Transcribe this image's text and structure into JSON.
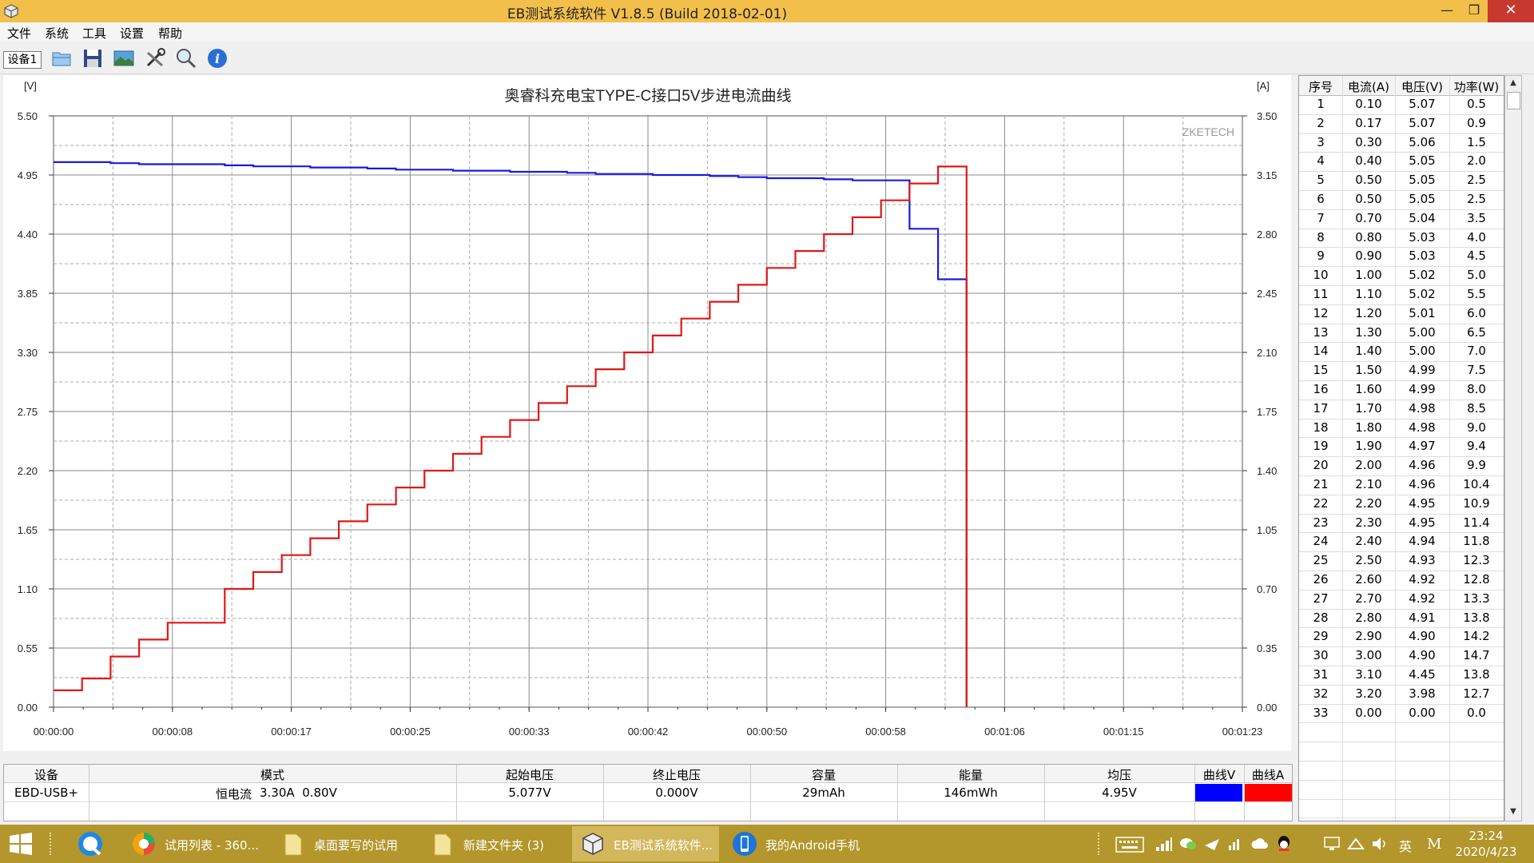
{
  "window": {
    "title": "EB测试系统软件 V1.8.5 (Build 2018-02-01)",
    "minimize": "—",
    "maximize": "❐",
    "close": "✕"
  },
  "menu": [
    "文件",
    "系统",
    "工具",
    "设置",
    "帮助"
  ],
  "toolbar": {
    "device_tab": "设备1",
    "tools": [
      "open-icon",
      "save-icon",
      "image-icon",
      "tools-icon",
      "search-icon",
      "info-icon"
    ]
  },
  "chart_data": {
    "type": "line",
    "title": "奥睿科充电宝TYPE-C接口5V步进电流曲线",
    "watermark": "ZKETECH",
    "y_left_unit": "[V]",
    "y_right_unit": "[A]",
    "y_left_ticks": [
      "5.50",
      "4.95",
      "4.40",
      "3.85",
      "3.30",
      "2.75",
      "2.20",
      "1.65",
      "1.10",
      "0.55",
      "0.00"
    ],
    "y_right_ticks": [
      "3.50",
      "3.15",
      "2.80",
      "2.45",
      "2.10",
      "1.75",
      "1.40",
      "1.05",
      "0.70",
      "0.35",
      "0.00"
    ],
    "x_ticks": [
      "00:00:00",
      "00:00:08",
      "00:00:17",
      "00:00:25",
      "00:00:33",
      "00:00:42",
      "00:00:50",
      "00:00:58",
      "00:01:06",
      "00:01:15",
      "00:01:23"
    ],
    "ylim_left": [
      0,
      5.5
    ],
    "ylim_right": [
      0,
      3.5
    ],
    "xlim_seconds": [
      0,
      83.33
    ],
    "grid": true,
    "step_seconds": 2,
    "series": [
      {
        "name": "曲线V",
        "axis": "left",
        "color": "#1a1adc",
        "values": [
          5.07,
          5.07,
          5.06,
          5.05,
          5.05,
          5.05,
          5.04,
          5.03,
          5.03,
          5.02,
          5.02,
          5.01,
          5.0,
          5.0,
          4.99,
          4.99,
          4.98,
          4.98,
          4.97,
          4.96,
          4.96,
          4.95,
          4.95,
          4.94,
          4.93,
          4.92,
          4.92,
          4.91,
          4.9,
          4.9,
          4.45,
          3.98,
          0.0
        ]
      },
      {
        "name": "曲线A",
        "axis": "right",
        "color": "#e01818",
        "values": [
          0.1,
          0.17,
          0.3,
          0.4,
          0.5,
          0.5,
          0.7,
          0.8,
          0.9,
          1.0,
          1.1,
          1.2,
          1.3,
          1.4,
          1.5,
          1.6,
          1.7,
          1.8,
          1.9,
          2.0,
          2.1,
          2.2,
          2.3,
          2.4,
          2.5,
          2.6,
          2.7,
          2.8,
          2.9,
          3.0,
          3.1,
          3.2,
          0.0
        ]
      }
    ]
  },
  "table": {
    "headers": [
      "序号",
      "电流(A)",
      "电压(V)",
      "功率(W)"
    ],
    "rows": [
      [
        "1",
        "0.10",
        "5.07",
        "0.5"
      ],
      [
        "2",
        "0.17",
        "5.07",
        "0.9"
      ],
      [
        "3",
        "0.30",
        "5.06",
        "1.5"
      ],
      [
        "4",
        "0.40",
        "5.05",
        "2.0"
      ],
      [
        "5",
        "0.50",
        "5.05",
        "2.5"
      ],
      [
        "6",
        "0.50",
        "5.05",
        "2.5"
      ],
      [
        "7",
        "0.70",
        "5.04",
        "3.5"
      ],
      [
        "8",
        "0.80",
        "5.03",
        "4.0"
      ],
      [
        "9",
        "0.90",
        "5.03",
        "4.5"
      ],
      [
        "10",
        "1.00",
        "5.02",
        "5.0"
      ],
      [
        "11",
        "1.10",
        "5.02",
        "5.5"
      ],
      [
        "12",
        "1.20",
        "5.01",
        "6.0"
      ],
      [
        "13",
        "1.30",
        "5.00",
        "6.5"
      ],
      [
        "14",
        "1.40",
        "5.00",
        "7.0"
      ],
      [
        "15",
        "1.50",
        "4.99",
        "7.5"
      ],
      [
        "16",
        "1.60",
        "4.99",
        "8.0"
      ],
      [
        "17",
        "1.70",
        "4.98",
        "8.5"
      ],
      [
        "18",
        "1.80",
        "4.98",
        "9.0"
      ],
      [
        "19",
        "1.90",
        "4.97",
        "9.4"
      ],
      [
        "20",
        "2.00",
        "4.96",
        "9.9"
      ],
      [
        "21",
        "2.10",
        "4.96",
        "10.4"
      ],
      [
        "22",
        "2.20",
        "4.95",
        "10.9"
      ],
      [
        "23",
        "2.30",
        "4.95",
        "11.4"
      ],
      [
        "24",
        "2.40",
        "4.94",
        "11.8"
      ],
      [
        "25",
        "2.50",
        "4.93",
        "12.3"
      ],
      [
        "26",
        "2.60",
        "4.92",
        "12.8"
      ],
      [
        "27",
        "2.70",
        "4.92",
        "13.3"
      ],
      [
        "28",
        "2.80",
        "4.91",
        "13.8"
      ],
      [
        "29",
        "2.90",
        "4.90",
        "14.2"
      ],
      [
        "30",
        "3.00",
        "4.90",
        "14.7"
      ],
      [
        "31",
        "3.10",
        "4.45",
        "13.8"
      ],
      [
        "32",
        "3.20",
        "3.98",
        "12.7"
      ],
      [
        "33",
        "0.00",
        "0.00",
        "0.0"
      ]
    ]
  },
  "summary": {
    "headers": [
      "设备",
      "模式",
      "起始电压",
      "终止电压",
      "容量",
      "能量",
      "均压",
      "曲线V",
      "曲线A"
    ],
    "device": "EBD-USB+",
    "mode_label": "恒电流",
    "mode_value": "3.30A  0.80V",
    "start_voltage": "5.077V",
    "end_voltage": "0.000V",
    "capacity": "29mAh",
    "energy": "146mWh",
    "avg_voltage": "4.95V",
    "curve_v_color": "#0000ff",
    "curve_a_color": "#ff0000"
  },
  "taskbar": {
    "tasks": [
      "试用列表 - 360...",
      "桌面要写的试用",
      "新建文件夹 (3)",
      "EB测试系统软件...",
      "我的Android手机"
    ],
    "ime": "英",
    "ime2": "M",
    "time": "23:24",
    "date": "2020/4/23"
  }
}
